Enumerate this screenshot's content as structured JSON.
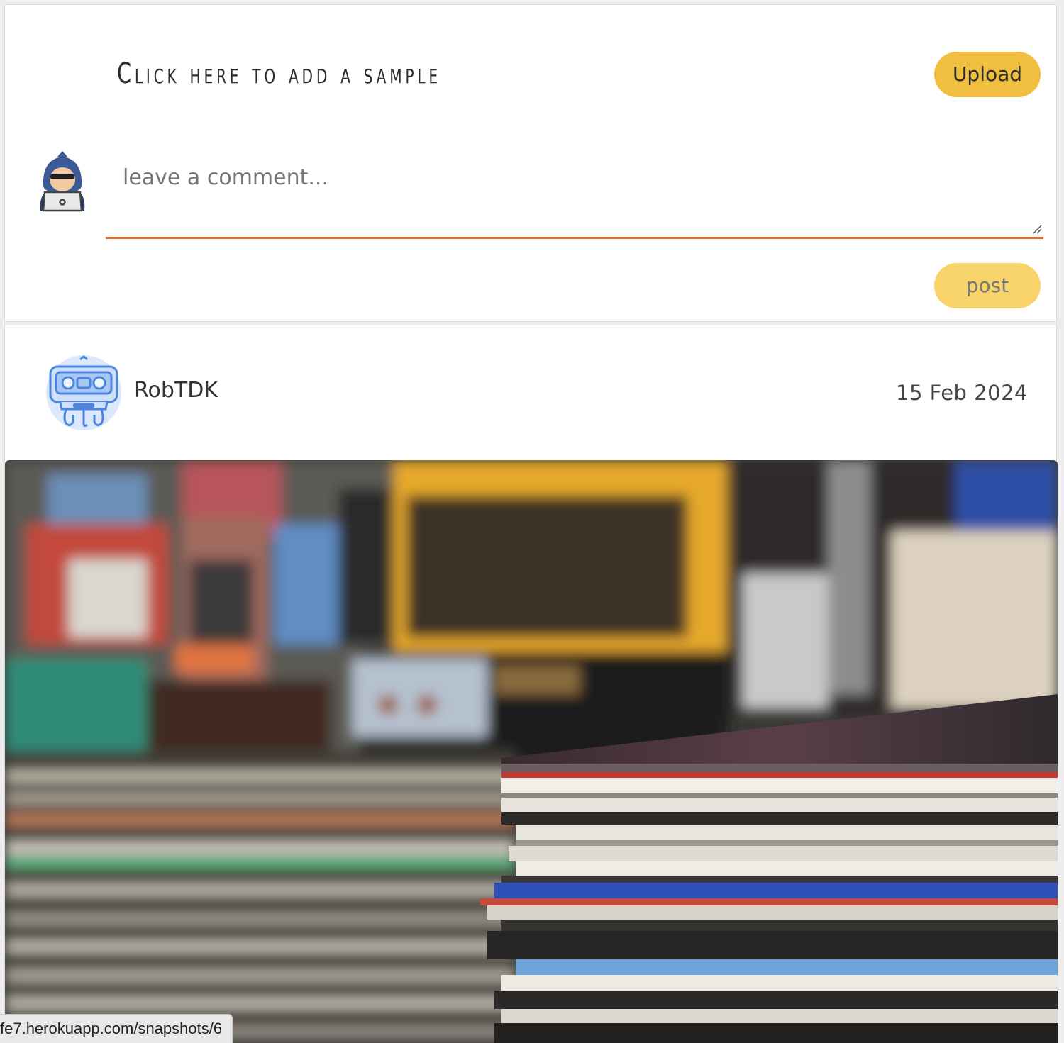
{
  "upload_form": {
    "add_sample_label": "Click here to add a sample",
    "upload_button": "Upload",
    "comment_placeholder": "leave a comment...",
    "post_button": "post"
  },
  "post": {
    "username": "RobTDK",
    "date": "15 Feb 2024"
  },
  "browser": {
    "status_url": "fe7.herokuapp.com/snapshots/6"
  },
  "colors": {
    "accent_orange": "#e06f2a",
    "button_yellow": "#f0bf40",
    "button_yellow_light": "#f7d36a",
    "avatar_blue": "#4a86e0"
  },
  "icons": {
    "logo": "sound-wave-icon",
    "commenter_avatar": "hacker-avatar-icon",
    "post_avatar": "cassette-robot-avatar-icon",
    "resize": "resize-handle-icon"
  }
}
